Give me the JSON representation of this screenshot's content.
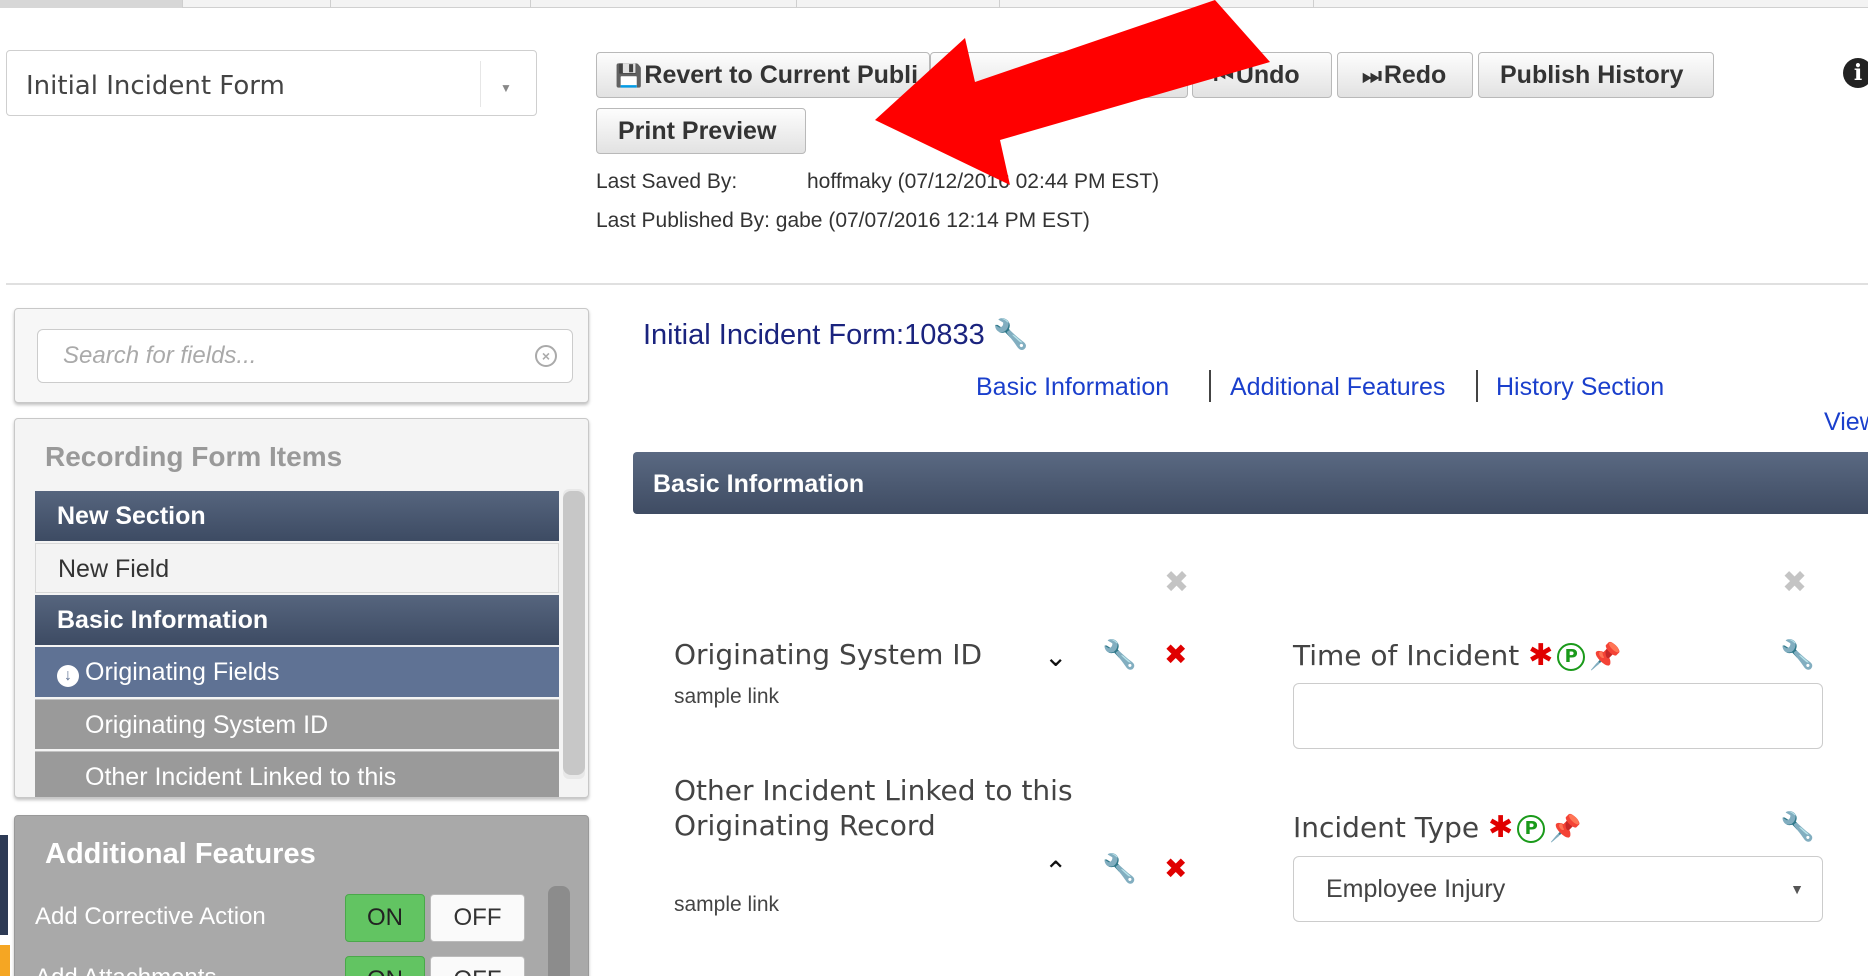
{
  "form_select": {
    "value": "Initial Incident Form"
  },
  "toolbar": {
    "revert_label": "Revert to Current Publi",
    "publish_label": "lish",
    "undo_label": "Undo",
    "redo_label": "Redo",
    "publish_history_label": "Publish History",
    "print_preview_label": "Print Preview"
  },
  "meta": {
    "last_saved_label": "Last Saved By:",
    "last_saved_value": "hoffmaky (07/12/2016 02:44 PM EST)",
    "last_published": "Last Published By: gabe (07/07/2016 12:14 PM EST)"
  },
  "sidebar": {
    "search_placeholder": "Search for fields...",
    "items_title": "Recording Form Items",
    "items": [
      {
        "label": "New Section"
      },
      {
        "label": "New Field"
      },
      {
        "label": "Basic Information"
      },
      {
        "label": "Originating Fields"
      },
      {
        "label": "Originating System ID"
      },
      {
        "label": "Other Incident Linked to this"
      }
    ],
    "features_title": "Additional Features",
    "features": [
      {
        "label": "Add Corrective Action",
        "on": "ON",
        "off": "OFF"
      },
      {
        "label": "Add Attachments",
        "on": "ON",
        "off": "OFF"
      }
    ]
  },
  "main": {
    "title": "Initial Incident Form:10833",
    "nav": [
      "Basic Information",
      "Additional Features",
      "History Section"
    ],
    "view_link": "View",
    "section_title": "Basic Information",
    "fields_left": [
      {
        "label": "Originating System ID",
        "link": "sample link"
      },
      {
        "label_line1": "Other Incident Linked to this",
        "label_line2": "Originating Record",
        "link": "sample link"
      }
    ],
    "fields_right": [
      {
        "label": "Time of Incident",
        "value": ""
      },
      {
        "label": "Incident Type",
        "value": "Employee Injury"
      }
    ]
  },
  "colors": {
    "arrow": "#ff0000",
    "section_bar": "#4a5871",
    "link": "#1a3fcc",
    "toggle_on": "#62c462"
  }
}
